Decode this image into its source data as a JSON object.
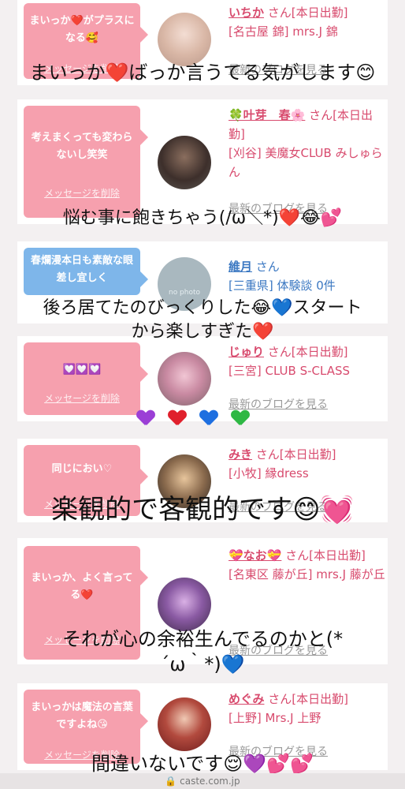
{
  "cards": [
    {
      "message": "まいっか❤️がプラスになる🥰",
      "delete": "メッセージを削除",
      "name": "いちか",
      "san": "さん[本日出勤]",
      "shop": "[名古屋 錦] mrs.J 錦",
      "blog": "最新のブログを見る"
    },
    {
      "message": "考えまくっても変わらないし笑笑",
      "delete": "メッセージを削除",
      "name": "🍀叶芽　春🌸",
      "san": "さん[本日出勤]",
      "shop": "[刈谷] 美魔女CLUB みしゅらん",
      "blog": "最新のブログを見る"
    },
    {
      "message": "春爛漫本日も素敵な眼差し宜しく",
      "delete": "",
      "name": "維月",
      "san": "さん",
      "shop": "[三重県] 体験談 0件",
      "blog": ""
    },
    {
      "message": "💟💟💟",
      "delete": "メッセージを削除",
      "name": "じゅり",
      "san": "さん[本日出勤]",
      "shop": "[三宮] CLUB S-CLASS",
      "blog": "最新のブログを見る"
    },
    {
      "message": "同じにおい♡",
      "delete": "メッセージを削除",
      "name": "みき",
      "san": "さん[本日出勤]",
      "shop": "[小牧] 縁dress",
      "blog": "最新のブログを見る"
    },
    {
      "message": "まいっか、よく言ってる❤️",
      "delete": "メッセージを削除",
      "name": "💝なお💝",
      "san": "さん[本日出勤]",
      "shop": "[名東区 藤が丘] mrs.J 藤が丘",
      "blog": "最新のブログを見る"
    },
    {
      "message": "まいっかは魔法の言葉ですよね😘",
      "delete": "メッセージを削除",
      "name": "めぐみ",
      "san": "さん[本日出勤]",
      "shop": "[上野] Mrs.J 上野",
      "blog": "最新のブログを見る"
    }
  ],
  "captions": {
    "c1": "まいっか❤️ばっか言うてる気がします😊",
    "c2": "悩む事に飽きちゃう(/ω＼*)❤️😂💕",
    "c3a": "後ろ居てたのびっくりした😂💙スタート",
    "c3b": "から楽しすぎた❤️",
    "c5": "楽観的で客観的です😊💓",
    "c6a": "それが心の余裕生んでるのかと(*",
    "c6b": "´ω｀*)💙",
    "c7": "間違いないです😌💜💕💕"
  },
  "avatar_alt": "no photo",
  "footer": "🔒 caste.com.jp",
  "colors": {
    "accent": "#d84b6e",
    "bubble_pink": "#f6a0ae",
    "bubble_blue": "#7eb6ea",
    "link_blue": "#3b78c2"
  }
}
